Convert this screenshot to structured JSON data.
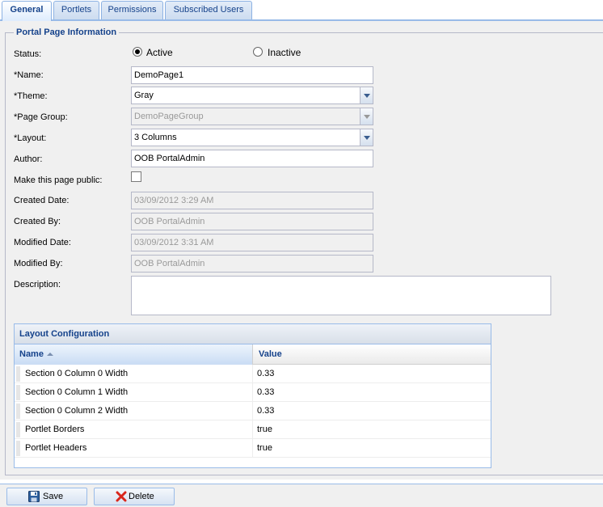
{
  "tabs": [
    {
      "label": "General",
      "active": true
    },
    {
      "label": "Portlets",
      "active": false
    },
    {
      "label": "Permissions",
      "active": false
    },
    {
      "label": "Subscribed Users",
      "active": false
    }
  ],
  "form": {
    "legend": "Portal Page Information",
    "status": {
      "label": "Status:",
      "active_label": "Active",
      "inactive_label": "Inactive",
      "selected": "Active"
    },
    "name": {
      "label": "*Name:",
      "value": "DemoPage1"
    },
    "theme": {
      "label": "*Theme:",
      "value": "Gray"
    },
    "page_group": {
      "label": "*Page Group:",
      "value": "DemoPageGroup"
    },
    "layout": {
      "label": "*Layout:",
      "value": "3 Columns"
    },
    "author": {
      "label": "Author:",
      "value": "OOB PortalAdmin"
    },
    "public": {
      "label": "Make this page public:",
      "checked": false
    },
    "created_date": {
      "label": "Created Date:",
      "value": "03/09/2012 3:29 AM"
    },
    "created_by": {
      "label": "Created By:",
      "value": "OOB PortalAdmin"
    },
    "modified_date": {
      "label": "Modified Date:",
      "value": "03/09/2012 3:31 AM"
    },
    "modified_by": {
      "label": "Modified By:",
      "value": "OOB PortalAdmin"
    },
    "description": {
      "label": "Description:",
      "value": ""
    }
  },
  "layout_config": {
    "title": "Layout Configuration",
    "columns": [
      "Name",
      "Value"
    ],
    "sort_column": "Name",
    "rows": [
      {
        "name": "Section 0 Column 0 Width",
        "value": "0.33"
      },
      {
        "name": "Section 0 Column 1 Width",
        "value": "0.33"
      },
      {
        "name": "Section 0 Column 2 Width",
        "value": "0.33"
      },
      {
        "name": "Portlet Borders",
        "value": "true"
      },
      {
        "name": "Portlet Headers",
        "value": "true"
      }
    ]
  },
  "buttons": {
    "save": {
      "label": "Save",
      "icon": "floppy-disk-icon"
    },
    "delete": {
      "label": "Delete",
      "icon": "red-x-icon"
    }
  },
  "colors": {
    "accent": "#15428b",
    "border": "#99bbe8",
    "delete_icon": "#d9261c",
    "save_icon": "#2d5f9e"
  }
}
